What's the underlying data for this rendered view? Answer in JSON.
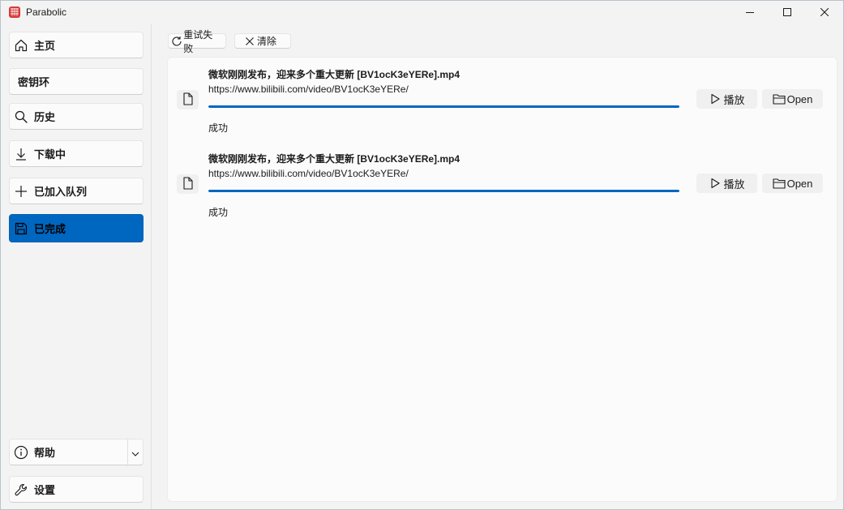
{
  "window": {
    "title": "Parabolic",
    "icons": {
      "app": "parabolic-logo-icon",
      "minimize": "minimize-icon",
      "maximize": "maximize-icon",
      "close": "close-icon"
    }
  },
  "sidebar": {
    "items": [
      {
        "label": "主页",
        "icon": "home-icon",
        "active": false
      },
      {
        "label": "密钥环",
        "icon": "",
        "active": false
      },
      {
        "label": "历史",
        "icon": "search-icon",
        "active": false
      },
      {
        "label": "下载中",
        "icon": "download-arrow-icon",
        "active": false
      },
      {
        "label": "已加入队列",
        "icon": "plus-icon",
        "active": false
      },
      {
        "label": "已完成",
        "icon": "save-disk-icon",
        "active": true
      }
    ],
    "footer": [
      {
        "label": "帮助",
        "icon": "info-icon",
        "expander_icon": "chevron-down-icon"
      },
      {
        "label": "设置",
        "icon": "wrench-icon"
      }
    ]
  },
  "toolbar": {
    "retry_label": "重试失败",
    "clear_label": "清除"
  },
  "downloads": [
    {
      "title": "微软刚刚发布，迎来多个重大更新 [BV1ocK3eYERe].mp4",
      "url": "https://www.bilibili.com/video/BV1ocK3eYERe/",
      "progress": 1.0,
      "status": "成功",
      "play_label": "播放",
      "open_label": "Open"
    },
    {
      "title": "微软刚刚发布，迎来多个重大更新 [BV1ocK3eYERe].mp4",
      "url": "https://www.bilibili.com/video/BV1ocK3eYERe/",
      "progress": 1.0,
      "status": "成功",
      "play_label": "播放",
      "open_label": "Open"
    }
  ],
  "colors": {
    "accent": "#0067c0",
    "window_bg": "#f3f3f3",
    "card_bg": "#fbfbfb"
  }
}
